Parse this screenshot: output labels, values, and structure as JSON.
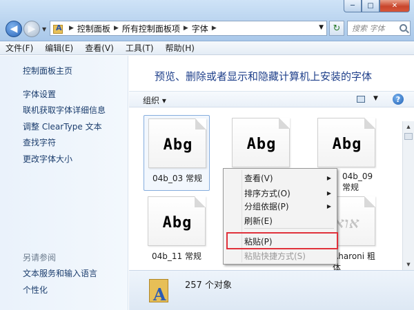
{
  "window": {
    "minimize": "─",
    "maximize": "□",
    "close": "✕"
  },
  "address": {
    "back_glyph": "◀",
    "forward_glyph": "▶",
    "crumbs": [
      "控制面板",
      "所有控制面板项",
      "字体"
    ],
    "refresh_glyph": "↻",
    "search_placeholder": "搜索 字体"
  },
  "menubar": [
    "文件(F)",
    "编辑(E)",
    "查看(V)",
    "工具(T)",
    "帮助(H)"
  ],
  "leftpane": {
    "home": "控制面板主页",
    "links": [
      "字体设置",
      "联机获取字体详细信息",
      "调整 ClearType 文本",
      "查找字符",
      "更改字体大小"
    ],
    "see_also_heading": "另请参阅",
    "see_also": [
      "文本服务和输入语言",
      "个性化"
    ]
  },
  "content": {
    "title": "预览、删除或者显示和隐藏计算机上安装的字体",
    "organize": "组织 ▾",
    "help": "?",
    "fonts": [
      {
        "sample": "Abg",
        "label": "04b_03 常规"
      },
      {
        "sample": "Abg",
        "label": ""
      },
      {
        "sample": "Abg",
        "label": "04b_09 常规"
      },
      {
        "sample": "Abg",
        "label": "04b_11 常规"
      },
      {
        "sample": "",
        "label": ""
      },
      {
        "sample": "אוא",
        "label": "Aharoni 粗体"
      }
    ],
    "details_count": "257 个对象"
  },
  "context_menu": {
    "items": [
      {
        "label": "查看(V)",
        "submenu": true
      },
      {
        "label": "排序方式(O)",
        "submenu": true
      },
      {
        "label": "分组依据(P)",
        "submenu": true
      },
      {
        "label": "刷新(E)",
        "submenu": false
      },
      {
        "label": "粘贴(P)",
        "submenu": false
      },
      {
        "label": "粘贴快捷方式(S)",
        "submenu": false
      }
    ],
    "submenu_glyph": "▶"
  },
  "colors": {
    "title_blue": "#1e3f8a",
    "link_blue": "#1b3d6d",
    "highlight_red": "#e0303a"
  }
}
